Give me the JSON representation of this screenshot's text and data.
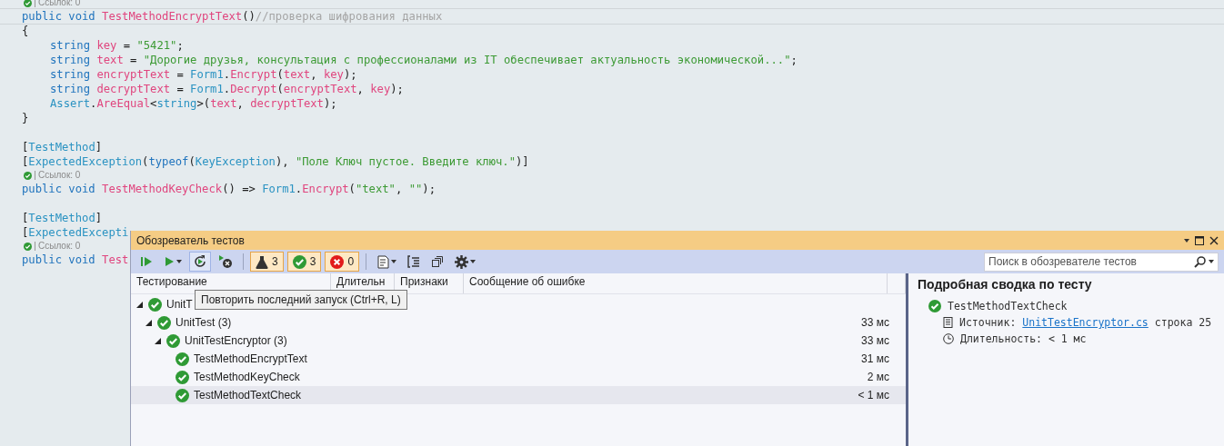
{
  "editor": {
    "lines": [
      {
        "kind": "codelens",
        "passed": true,
        "text": "Ссылок: 0"
      },
      {
        "kind": "code",
        "current": true,
        "indent": false,
        "tokens": [
          {
            "kind": "kw",
            "s": "public void "
          },
          {
            "kind": "ident",
            "s": "TestMethodEncryptText"
          },
          {
            "kind": "plain",
            "s": "()"
          },
          {
            "kind": "comment",
            "s": "//проверка шифрования данных"
          }
        ]
      },
      {
        "kind": "code",
        "current": false,
        "indent": false,
        "tokens": [
          {
            "kind": "plain",
            "s": "{"
          }
        ]
      },
      {
        "kind": "code",
        "current": false,
        "indent": true,
        "tokens": [
          {
            "kind": "kw",
            "s": "string "
          },
          {
            "kind": "ident",
            "s": "key"
          },
          {
            "kind": "plain",
            "s": " = "
          },
          {
            "kind": "str",
            "s": "\"5421\""
          },
          {
            "kind": "plain",
            "s": ";"
          }
        ]
      },
      {
        "kind": "code",
        "current": false,
        "indent": true,
        "tokens": [
          {
            "kind": "kw",
            "s": "string "
          },
          {
            "kind": "ident",
            "s": "text"
          },
          {
            "kind": "plain",
            "s": " = "
          },
          {
            "kind": "str",
            "s": "\"Дорогие друзья, консультация с профессионалами из IT обеспечивает актуальность экономической...\""
          },
          {
            "kind": "plain",
            "s": ";"
          }
        ]
      },
      {
        "kind": "code",
        "current": false,
        "indent": true,
        "tokens": [
          {
            "kind": "kw",
            "s": "string "
          },
          {
            "kind": "ident",
            "s": "encryptText"
          },
          {
            "kind": "plain",
            "s": " = "
          },
          {
            "kind": "type",
            "s": "Form1"
          },
          {
            "kind": "plain",
            "s": "."
          },
          {
            "kind": "ident",
            "s": "Encrypt"
          },
          {
            "kind": "plain",
            "s": "("
          },
          {
            "kind": "ident",
            "s": "text"
          },
          {
            "kind": "plain",
            "s": ", "
          },
          {
            "kind": "ident",
            "s": "key"
          },
          {
            "kind": "plain",
            "s": ");"
          }
        ]
      },
      {
        "kind": "code",
        "current": false,
        "indent": true,
        "tokens": [
          {
            "kind": "kw",
            "s": "string "
          },
          {
            "kind": "ident",
            "s": "decryptText"
          },
          {
            "kind": "plain",
            "s": " = "
          },
          {
            "kind": "type",
            "s": "Form1"
          },
          {
            "kind": "plain",
            "s": "."
          },
          {
            "kind": "ident",
            "s": "Decrypt"
          },
          {
            "kind": "plain",
            "s": "("
          },
          {
            "kind": "ident",
            "s": "encryptText"
          },
          {
            "kind": "plain",
            "s": ", "
          },
          {
            "kind": "ident",
            "s": "key"
          },
          {
            "kind": "plain",
            "s": ");"
          }
        ]
      },
      {
        "kind": "code",
        "current": false,
        "indent": true,
        "tokens": [
          {
            "kind": "type",
            "s": "Assert"
          },
          {
            "kind": "plain",
            "s": "."
          },
          {
            "kind": "ident",
            "s": "AreEqual"
          },
          {
            "kind": "plain",
            "s": "<"
          },
          {
            "kind": "type",
            "s": "string"
          },
          {
            "kind": "plain",
            "s": ">("
          },
          {
            "kind": "ident",
            "s": "text"
          },
          {
            "kind": "plain",
            "s": ", "
          },
          {
            "kind": "ident",
            "s": "decryptText"
          },
          {
            "kind": "plain",
            "s": ");"
          }
        ]
      },
      {
        "kind": "code",
        "current": false,
        "indent": false,
        "tokens": [
          {
            "kind": "plain",
            "s": "}"
          }
        ]
      },
      {
        "kind": "blank"
      },
      {
        "kind": "code",
        "current": false,
        "indent": false,
        "tokens": [
          {
            "kind": "plain",
            "s": "["
          },
          {
            "kind": "type",
            "s": "TestMethod"
          },
          {
            "kind": "plain",
            "s": "]"
          }
        ]
      },
      {
        "kind": "code",
        "current": false,
        "indent": false,
        "tokens": [
          {
            "kind": "plain",
            "s": "["
          },
          {
            "kind": "type",
            "s": "ExpectedException"
          },
          {
            "kind": "plain",
            "s": "("
          },
          {
            "kind": "kw",
            "s": "typeof"
          },
          {
            "kind": "plain",
            "s": "("
          },
          {
            "kind": "type",
            "s": "KeyException"
          },
          {
            "kind": "plain",
            "s": "), "
          },
          {
            "kind": "str",
            "s": "\"Поле Ключ пустое. Введите ключ.\""
          },
          {
            "kind": "plain",
            "s": ")]"
          }
        ]
      },
      {
        "kind": "codelens",
        "passed": true,
        "text": "Ссылок: 0"
      },
      {
        "kind": "code",
        "current": false,
        "indent": false,
        "tokens": [
          {
            "kind": "kw",
            "s": "public void "
          },
          {
            "kind": "ident",
            "s": "TestMethodKeyCheck"
          },
          {
            "kind": "plain",
            "s": "() => "
          },
          {
            "kind": "type",
            "s": "Form1"
          },
          {
            "kind": "plain",
            "s": "."
          },
          {
            "kind": "ident",
            "s": "Encrypt"
          },
          {
            "kind": "plain",
            "s": "("
          },
          {
            "kind": "str",
            "s": "\"text\""
          },
          {
            "kind": "plain",
            "s": ", "
          },
          {
            "kind": "str",
            "s": "\"\""
          },
          {
            "kind": "plain",
            "s": ");"
          }
        ]
      },
      {
        "kind": "blank"
      },
      {
        "kind": "code",
        "current": false,
        "indent": false,
        "tokens": [
          {
            "kind": "plain",
            "s": "["
          },
          {
            "kind": "type",
            "s": "TestMethod"
          },
          {
            "kind": "plain",
            "s": "]"
          }
        ]
      },
      {
        "kind": "code",
        "current": false,
        "indent": false,
        "tokens": [
          {
            "kind": "plain",
            "s": "["
          },
          {
            "kind": "type",
            "s": "ExpectedExcepti"
          }
        ]
      },
      {
        "kind": "codelens",
        "passed": true,
        "text": "Ссылок: 0"
      },
      {
        "kind": "code",
        "current": false,
        "indent": false,
        "tokens": [
          {
            "kind": "kw",
            "s": "public void "
          },
          {
            "kind": "ident",
            "s": "Test"
          }
        ]
      }
    ]
  },
  "test_explorer": {
    "title": "Обозреватель тестов",
    "toolbar": {
      "counters": [
        {
          "kind": "total",
          "count": "3"
        },
        {
          "kind": "passed",
          "count": "3"
        },
        {
          "kind": "failed",
          "count": "0"
        }
      ],
      "search": {
        "placeholder": "Поиск в обозревателе тестов"
      }
    },
    "tooltip": "Повторить последний запуск (Ctrl+R, L)",
    "columns": [
      "Тестирование",
      "Длительн",
      "Признаки",
      "Сообщение об ошибке"
    ],
    "tree": [
      {
        "label": "UnitT",
        "passed": true,
        "expanded": true,
        "selected": false,
        "children": [
          {
            "label": "UnitTest (3)",
            "duration": "33 мс",
            "passed": true,
            "expanded": true,
            "selected": false,
            "children": [
              {
                "label": "UnitTestEncryptor (3)",
                "duration": "33 мс",
                "passed": true,
                "expanded": true,
                "selected": false,
                "children": [
                  {
                    "label": "TestMethodEncryptText",
                    "duration": "31 мс",
                    "passed": true,
                    "selected": false
                  },
                  {
                    "label": "TestMethodKeyCheck",
                    "duration": "2 мс",
                    "passed": true,
                    "selected": false
                  },
                  {
                    "label": "TestMethodTextCheck",
                    "duration": "< 1 мс",
                    "passed": true,
                    "selected": true
                  }
                ]
              }
            ]
          }
        ]
      }
    ],
    "details": {
      "heading": "Подробная сводка по тесту",
      "test_name": "TestMethodTextCheck",
      "passed": true,
      "source_label": "Источник:",
      "source_link": "UnitTestEncryptor.cs",
      "source_line": "строка 25",
      "duration": "Длительность: < 1 мс"
    }
  }
}
